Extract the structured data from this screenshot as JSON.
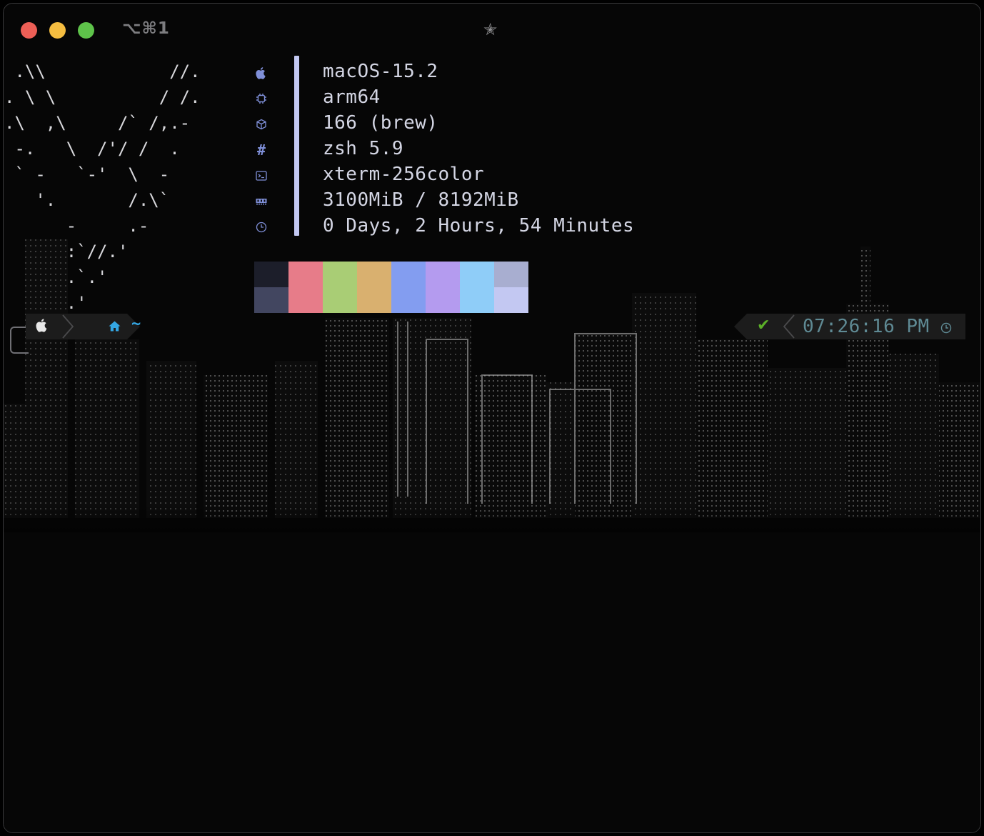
{
  "window": {
    "tab_title": "⌥⌘1",
    "traffic_lights": {
      "close": "#ed5f56",
      "minimize": "#f5bd40",
      "zoom": "#5ec34a"
    },
    "star_icon": "star-icon"
  },
  "ascii_logo": [
    " .\\\\            //.",
    ". \\ \\          / /.",
    ".\\  ,\\     /` /,.-",
    " -.   \\  /'/ /  .",
    " ` -   `-'  \\  -",
    "   '.       /.\\`",
    "      -     .-",
    "      :`//.'",
    "      .`.'",
    "      .'"
  ],
  "info_icons": [
    "apple-icon",
    "cpu-icon",
    "package-icon",
    "hash-icon",
    "terminal-icon",
    "memory-icon",
    "clock-icon"
  ],
  "info_rows": [
    "macOS-15.2",
    "arm64",
    "166 (brew)",
    "zsh 5.9",
    "xterm-256color",
    "3100MiB / 8192MiB",
    "0 Days, 2 Hours, 54 Minutes"
  ],
  "palette": {
    "normal": [
      "#1c1e2a",
      "#e77c89",
      "#a9cd75",
      "#d9b06f",
      "#839df0",
      "#b49bef",
      "#8fcdf8",
      "#a8aed0"
    ],
    "bright": [
      "#424660",
      "#e77c89",
      "#a9cd75",
      "#d9b06f",
      "#839df0",
      "#b49bef",
      "#8fcdf8",
      "#c3c8f2"
    ]
  },
  "prompt": {
    "os_icon": "apple-icon",
    "dir_icon": "home-icon",
    "dir": "~",
    "status_icon": "✔",
    "time": "07:26:16 PM",
    "time_icon": "clock-icon"
  },
  "colors": {
    "accent_bar": "#c2c8f2",
    "icon_color": "#7f8fd8",
    "dir_color": "#34a7e4",
    "ok_color": "#5bb028",
    "time_color": "#5f8a94"
  }
}
